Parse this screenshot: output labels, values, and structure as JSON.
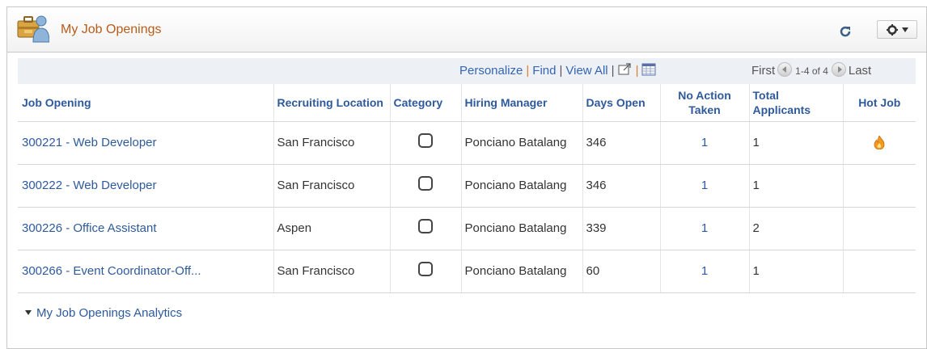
{
  "header": {
    "title": "My Job Openings",
    "icon": "briefcase-person-icon",
    "refresh_icon": "refresh-icon",
    "gear_icon": "gear-icon"
  },
  "grid_nav": {
    "personalize": "Personalize",
    "find": "Find",
    "view_all": "View All",
    "first": "First",
    "count": "1-4 of 4",
    "last": "Last"
  },
  "columns": [
    "Job Opening",
    "Recruiting Location",
    "Category",
    "Hiring Manager",
    "Days Open",
    "No Action Taken",
    "Total Applicants",
    "Hot Job"
  ],
  "rows": [
    {
      "job": "300221 - Web Developer",
      "location": "San Francisco",
      "manager": "Ponciano Batalang",
      "days": "346",
      "no_action": "1",
      "applicants": "1",
      "hot": true
    },
    {
      "job": "300222 - Web Developer",
      "location": "San Francisco",
      "manager": "Ponciano Batalang",
      "days": "346",
      "no_action": "1",
      "applicants": "1",
      "hot": false
    },
    {
      "job": "300226 - Office Assistant",
      "location": "Aspen",
      "manager": "Ponciano Batalang",
      "days": "339",
      "no_action": "1",
      "applicants": "2",
      "hot": false
    },
    {
      "job": "300266 - Event Coordinator-Off...",
      "location": "San Francisco",
      "manager": "Ponciano Batalang",
      "days": "60",
      "no_action": "1",
      "applicants": "1",
      "hot": false
    }
  ],
  "analytics_label": "My Job Openings Analytics",
  "colors": {
    "title": "#b85c1a",
    "link": "#2e5a9c",
    "nav_bg": "#edf1f6"
  }
}
